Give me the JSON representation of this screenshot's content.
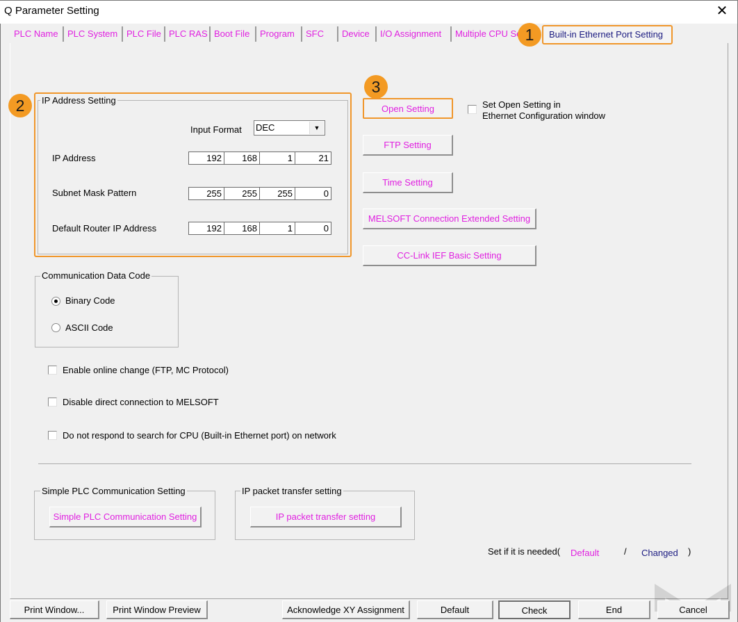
{
  "window": {
    "title": "Q Parameter Setting",
    "close_icon": "close-x"
  },
  "tabs": [
    {
      "label": "PLC Name"
    },
    {
      "label": "PLC System"
    },
    {
      "label": "PLC File"
    },
    {
      "label": "PLC RAS"
    },
    {
      "label": "Boot File"
    },
    {
      "label": "Program"
    },
    {
      "label": "SFC"
    },
    {
      "label": "Device"
    },
    {
      "label": "I/O Assignment"
    },
    {
      "label": "Multiple CPU Se"
    },
    {
      "label": "Built-in Ethernet Port Setting",
      "active": true
    }
  ],
  "badges": {
    "one": "1",
    "two": "2",
    "three": "3"
  },
  "ip_group": {
    "title": "IP Address Setting",
    "input_format_label": "Input Format",
    "input_format_value": "DEC",
    "rows": [
      {
        "label": "IP Address",
        "octets": [
          "192",
          "168",
          "1",
          "21"
        ]
      },
      {
        "label": "Subnet Mask Pattern",
        "octets": [
          "255",
          "255",
          "255",
          "0"
        ]
      },
      {
        "label": "Default Router IP Address",
        "octets": [
          "192",
          "168",
          "1",
          "0"
        ]
      }
    ]
  },
  "right_buttons": {
    "open_setting": "Open Setting",
    "open_setting_checkbox_line1": "Set Open Setting in",
    "open_setting_checkbox_line2": "Ethernet Configuration window",
    "ftp_setting": "FTP Setting",
    "time_setting": "Time Setting",
    "melsoft_ext": "MELSOFT Connection Extended Setting",
    "cclink": "CC-Link IEF Basic Setting"
  },
  "comm_code": {
    "title": "Communication Data Code",
    "options": [
      {
        "label": "Binary Code",
        "selected": true
      },
      {
        "label": "ASCII Code",
        "selected": false
      }
    ]
  },
  "checkboxes": [
    {
      "label": "Enable online change (FTP, MC Protocol)",
      "checked": false
    },
    {
      "label": "Disable direct connection to MELSOFT",
      "checked": false
    },
    {
      "label": "Do not respond to search for CPU (Built-in Ethernet port) on network",
      "checked": false
    }
  ],
  "simple_plc": {
    "title": "Simple PLC Communication Setting",
    "button": "Simple PLC Communication Setting"
  },
  "ip_packet": {
    "title": "IP packet transfer setting",
    "button": "IP packet transfer setting"
  },
  "legend": {
    "prefix": "Set if it is needed(",
    "default": "Default",
    "slash": "/",
    "changed": "Changed",
    "suffix": ")"
  },
  "colors": {
    "default_text": "#e020e0",
    "changed_text": "#1a1a80",
    "highlight": "#f0962a",
    "badge": "#f39a23"
  },
  "bottom_buttons": {
    "print_window": "Print Window...",
    "print_preview": "Print Window Preview",
    "ack_xy": "Acknowledge XY Assignment",
    "default": "Default",
    "check": "Check",
    "end": "End",
    "cancel": "Cancel"
  }
}
